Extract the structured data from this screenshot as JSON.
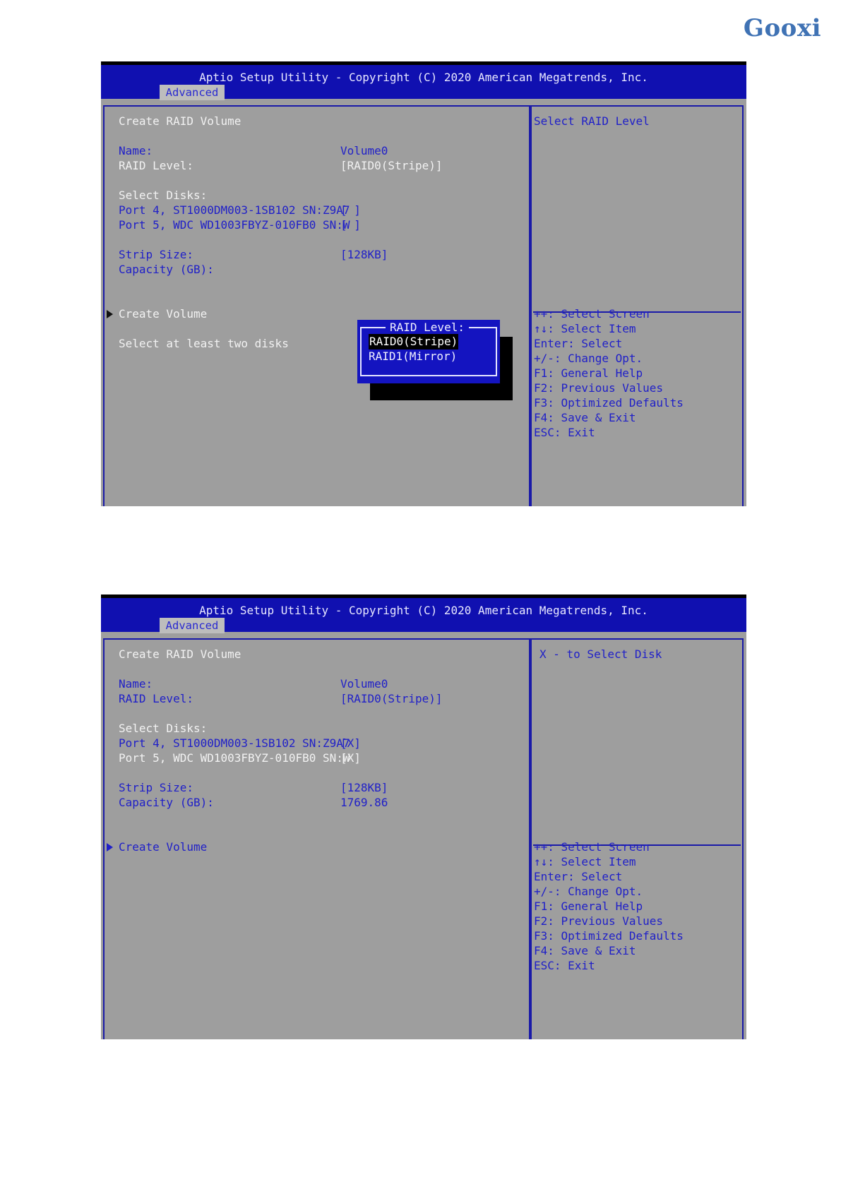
{
  "logo": "Gooxi",
  "screens": [
    {
      "title": "Aptio Setup Utility - Copyright (C) 2020 American Megatrends, Inc.",
      "tab": "Advanced",
      "heading": "Create RAID Volume",
      "name_label": "Name:",
      "name_value": "Volume0",
      "raid_level_label": "RAID Level:",
      "raid_level_value": "[RAID0(Stripe)]",
      "select_disks_label": "Select Disks:",
      "disks": [
        {
          "label": "Port 4, ST1000DM003-1SB102 SN:Z9A7",
          "value": "[ ]"
        },
        {
          "label": "Port 5, WDC WD1003FBYZ-010FB0 SN:W",
          "value": "[ ]"
        }
      ],
      "strip_size_label": "Strip Size:",
      "strip_size_value": "[128KB]",
      "capacity_label": "Capacity (GB):",
      "capacity_value": "",
      "create_volume": "Create Volume",
      "note": "Select at least two disks",
      "help": "Select RAID Level",
      "popup": {
        "title": "RAID Level:",
        "options": [
          "RAID0(Stripe)",
          "RAID1(Mirror)"
        ],
        "selected": "RAID0(Stripe)"
      },
      "keys": [
        "++: Select Screen",
        "↑↓: Select Item",
        "Enter: Select",
        "+/-: Change Opt.",
        "F1: General Help",
        "F2: Previous Values",
        "F3: Optimized Defaults",
        "F4: Save & Exit",
        "ESC: Exit"
      ]
    },
    {
      "title": "Aptio Setup Utility - Copyright (C) 2020 American Megatrends, Inc.",
      "tab": "Advanced",
      "heading": "Create RAID Volume",
      "name_label": "Name:",
      "name_value": "Volume0",
      "raid_level_label": "RAID Level:",
      "raid_level_value": "[RAID0(Stripe)]",
      "select_disks_label": "Select Disks:",
      "disks": [
        {
          "label": "Port 4, ST1000DM003-1SB102 SN:Z9A7",
          "value": "[X]"
        },
        {
          "label": "Port 5, WDC WD1003FBYZ-010FB0 SN:W",
          "value": "[X]"
        }
      ],
      "strip_size_label": "Strip Size:",
      "strip_size_value": "[128KB]",
      "capacity_label": "Capacity (GB):",
      "capacity_value": "1769.86",
      "create_volume": "Create Volume",
      "help": "X - to Select Disk",
      "keys": [
        "++: Select Screen",
        "↑↓: Select Item",
        "Enter: Select",
        "+/-: Change Opt.",
        "F1: General Help",
        "F2: Previous Values",
        "F3: Optimized Defaults",
        "F4: Save & Exit",
        "ESC: Exit"
      ]
    }
  ]
}
